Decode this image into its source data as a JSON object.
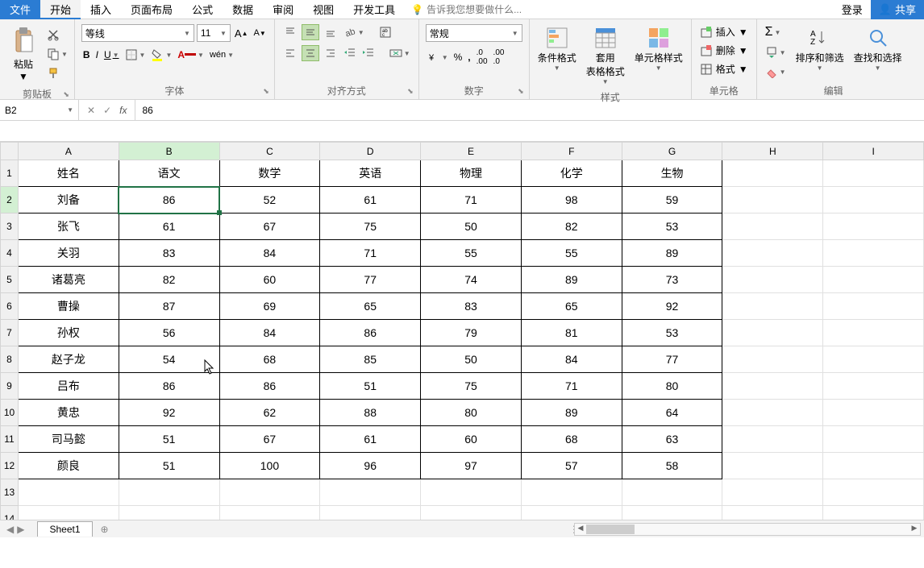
{
  "menu": {
    "file": "文件",
    "home": "开始",
    "insert": "插入",
    "layout": "页面布局",
    "formulas": "公式",
    "data": "数据",
    "review": "审阅",
    "view": "视图",
    "dev": "开发工具",
    "tellme": "告诉我您想要做什么...",
    "login": "登录",
    "share": "共享"
  },
  "ribbon": {
    "clipboard": {
      "label": "剪贴板",
      "paste": "粘贴"
    },
    "font": {
      "label": "字体",
      "name": "等线",
      "size": "11"
    },
    "align": {
      "label": "对齐方式"
    },
    "number": {
      "label": "数字",
      "format": "常规"
    },
    "styles": {
      "label": "样式",
      "cond": "条件格式",
      "table": "套用\n表格格式",
      "cell": "单元格样式"
    },
    "cells": {
      "label": "单元格",
      "insert": "插入",
      "delete": "删除",
      "format": "格式"
    },
    "editing": {
      "label": "编辑",
      "sort": "排序和筛选",
      "find": "查找和选择"
    }
  },
  "namebox": "B2",
  "formula": "86",
  "columns": [
    "A",
    "B",
    "C",
    "D",
    "E",
    "F",
    "G",
    "H",
    "I"
  ],
  "headers": [
    "姓名",
    "语文",
    "数学",
    "英语",
    "物理",
    "化学",
    "生物"
  ],
  "rows": [
    [
      "刘备",
      "86",
      "52",
      "61",
      "71",
      "98",
      "59"
    ],
    [
      "张飞",
      "61",
      "67",
      "75",
      "50",
      "82",
      "53"
    ],
    [
      "关羽",
      "83",
      "84",
      "71",
      "55",
      "55",
      "89"
    ],
    [
      "诸葛亮",
      "82",
      "60",
      "77",
      "74",
      "89",
      "73"
    ],
    [
      "曹操",
      "87",
      "69",
      "65",
      "83",
      "65",
      "92"
    ],
    [
      "孙权",
      "56",
      "84",
      "86",
      "79",
      "81",
      "53"
    ],
    [
      "赵子龙",
      "54",
      "68",
      "85",
      "50",
      "84",
      "77"
    ],
    [
      "吕布",
      "86",
      "86",
      "51",
      "75",
      "71",
      "80"
    ],
    [
      "黄忠",
      "92",
      "62",
      "88",
      "80",
      "89",
      "64"
    ],
    [
      "司马懿",
      "51",
      "67",
      "61",
      "60",
      "68",
      "63"
    ],
    [
      "颜良",
      "51",
      "100",
      "96",
      "97",
      "57",
      "58"
    ]
  ],
  "activeCell": {
    "row": 2,
    "col": 2
  },
  "totalRows": 14,
  "sheet": {
    "name": "Sheet1"
  }
}
